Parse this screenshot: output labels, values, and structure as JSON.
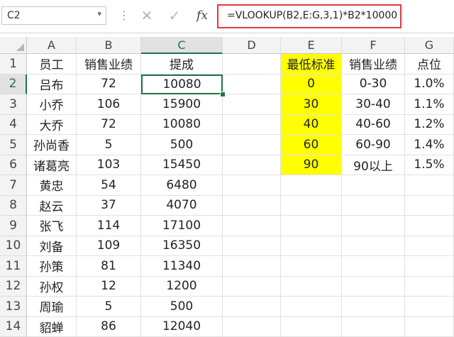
{
  "name_box": {
    "value": "C2",
    "dropdown": "▾"
  },
  "formula_bar": {
    "dots": "⋮",
    "cancel": "✕",
    "enter": "✓",
    "fx": "fx",
    "formula": "=VLOOKUP(B2,E:G,3,1)*B2*10000"
  },
  "columns": [
    "A",
    "B",
    "C",
    "D",
    "E",
    "F",
    "G"
  ],
  "rows": [
    "1",
    "2",
    "3",
    "4",
    "5",
    "6",
    "7",
    "8",
    "9",
    "10",
    "11",
    "12",
    "13",
    "14"
  ],
  "colors": {
    "highlight": "#ffff00",
    "selection": "#217346",
    "formula_border": "#e03a3a"
  },
  "sheet": [
    [
      "员工",
      "销售业绩",
      "提成",
      "",
      "最低标准",
      "销售业绩",
      "点位"
    ],
    [
      "吕布",
      "72",
      "10080",
      "",
      "0",
      "0-30",
      "1.0%"
    ],
    [
      "小乔",
      "106",
      "15900",
      "",
      "30",
      "30-40",
      "1.1%"
    ],
    [
      "大乔",
      "72",
      "10080",
      "",
      "40",
      "40-60",
      "1.2%"
    ],
    [
      "孙尚香",
      "5",
      "500",
      "",
      "60",
      "60-90",
      "1.4%"
    ],
    [
      "诸葛亮",
      "103",
      "15450",
      "",
      "90",
      "90以上",
      "1.5%"
    ],
    [
      "黄忠",
      "54",
      "6480",
      "",
      "",
      "",
      ""
    ],
    [
      "赵云",
      "37",
      "4070",
      "",
      "",
      "",
      ""
    ],
    [
      "张飞",
      "114",
      "17100",
      "",
      "",
      "",
      ""
    ],
    [
      "刘备",
      "109",
      "16350",
      "",
      "",
      "",
      ""
    ],
    [
      "孙策",
      "81",
      "11340",
      "",
      "",
      "",
      ""
    ],
    [
      "孙权",
      "12",
      "1200",
      "",
      "",
      "",
      ""
    ],
    [
      "周瑜",
      "5",
      "500",
      "",
      "",
      "",
      ""
    ],
    [
      "貂蝉",
      "86",
      "12040",
      "",
      "",
      "",
      ""
    ]
  ],
  "highlighted_cells": [
    "E1",
    "E2",
    "E3",
    "E4",
    "E5",
    "E6"
  ],
  "active_cell": "C2"
}
